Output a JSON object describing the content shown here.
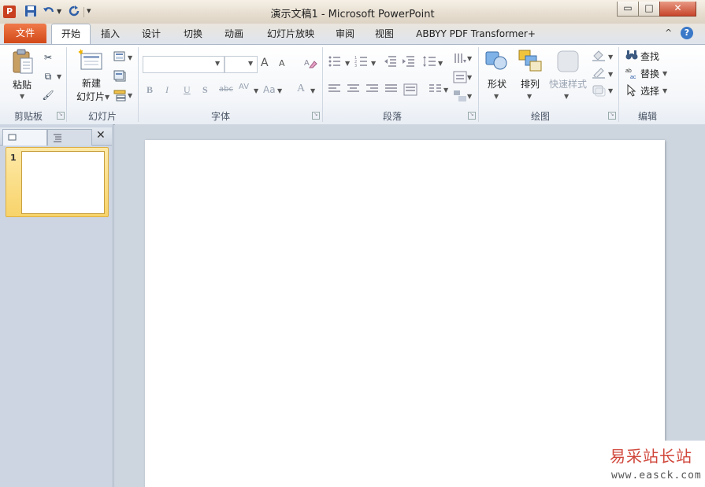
{
  "window": {
    "title": "演示文稿1 - Microsoft PowerPoint",
    "app_icon_letter": "P",
    "controls": {
      "minimize": "▭",
      "maximize": "□",
      "close": "✕"
    }
  },
  "quick_access": [
    {
      "name": "save-icon",
      "glyph": "💾"
    },
    {
      "name": "undo-icon",
      "glyph": "↶"
    },
    {
      "name": "redo-icon",
      "glyph": "↻"
    },
    {
      "name": "customize-icon",
      "glyph": "⩡"
    }
  ],
  "tabs": {
    "file": "文件",
    "items": [
      "开始",
      "插入",
      "设计",
      "切换",
      "动画",
      "幻灯片放映",
      "审阅",
      "视图",
      "ABBYY PDF Transformer+"
    ],
    "active": "开始",
    "help": "?",
    "minimize_ribbon": "^"
  },
  "ribbon": {
    "clipboard": {
      "label": "剪贴板",
      "paste": "粘贴",
      "cut_glyph": "✂",
      "copy_glyph": "⧉",
      "format_painter_glyph": "🖌"
    },
    "slides": {
      "label": "幻灯片",
      "new_slide_line1": "新建",
      "new_slide_line2": "幻灯片"
    },
    "font": {
      "label": "字体",
      "bold": "B",
      "italic": "I",
      "underline": "U",
      "shadow": "S",
      "strike": "abc",
      "spacing": "AV",
      "case": "Aa",
      "color": "A",
      "grow": "A",
      "shrink": "A"
    },
    "paragraph": {
      "label": "段落"
    },
    "drawing": {
      "label": "绘图",
      "shapes": "形状",
      "arrange": "排列",
      "quick_styles": "快速样式"
    },
    "editing": {
      "label": "编辑",
      "find": "查找",
      "replace": "替换",
      "select": "选择"
    }
  },
  "slide_pane": {
    "thumbnails": [
      {
        "number": "1"
      }
    ],
    "close_glyph": "✕"
  },
  "watermark": {
    "text": "易采站长站",
    "url": "www.easck.com"
  }
}
